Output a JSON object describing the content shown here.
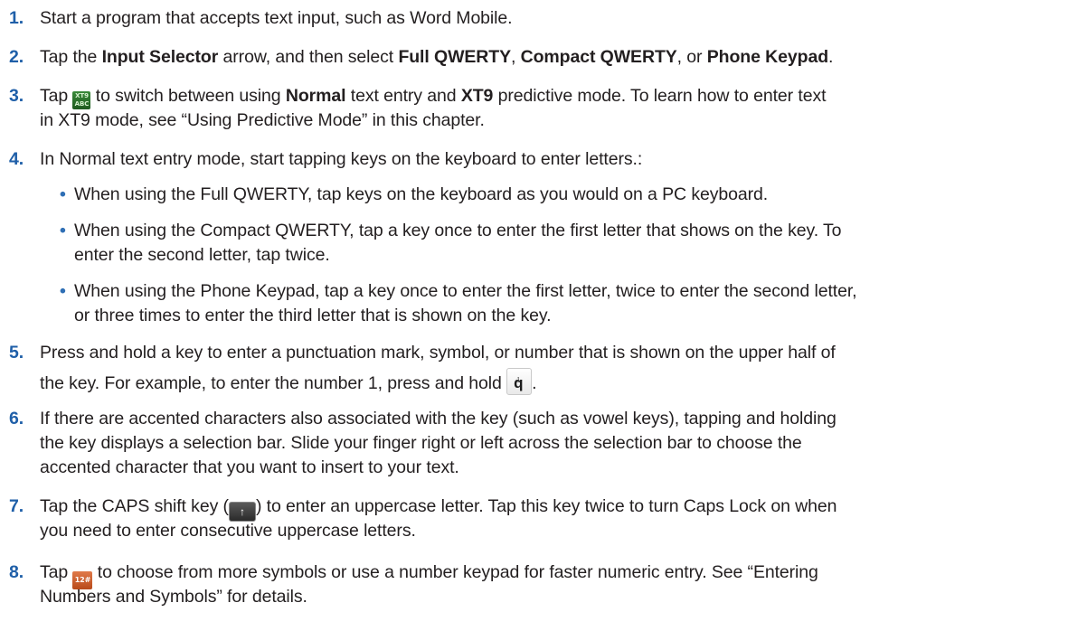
{
  "steps": {
    "s1": {
      "num": "1.",
      "text": "Start a program that accepts text input, such as Word Mobile."
    },
    "s2": {
      "num": "2.",
      "t1": "Tap the ",
      "b1": "Input Selector",
      "t2": " arrow, and then select ",
      "b2": "Full QWERTY",
      "t3": ", ",
      "b3": "Compact QWERTY",
      "t4": ", or ",
      "b4": "Phone Keypad",
      "t5": "."
    },
    "s3": {
      "num": "3.",
      "t1": "Tap ",
      "t2": " to switch between using ",
      "b1": "Normal",
      "t3": " text entry and ",
      "b2": "XT9",
      "t4": " predictive mode. To learn how to enter text",
      "line2": "in XT9 mode, see “Using Predictive Mode” in this chapter."
    },
    "s4": {
      "num": "4.",
      "text": "In Normal text entry mode, start tapping keys on the keyboard to enter letters.:",
      "bullets": [
        {
          "line1": "When using the Full QWERTY, tap keys on the keyboard as you would on a PC keyboard."
        },
        {
          "line1": "When using the Compact QWERTY, tap a key once to enter the first letter that shows on the key. To",
          "line2": "enter the second letter, tap twice."
        },
        {
          "line1": "When using the Phone Keypad, tap a key once to enter the first letter, twice to enter the second letter,",
          "line2": "or three times to enter the third letter that is shown on the key."
        }
      ]
    },
    "s5": {
      "num": "5.",
      "line1": "Press and hold a key to enter a punctuation mark, symbol, or number that is shown on the upper half of",
      "line2a": "the key. For example, to enter the number 1, press and hold ",
      "line2b": "."
    },
    "s6": {
      "num": "6.",
      "line1": "If there are accented characters also associated with the key (such as vowel keys), tapping and holding",
      "line2": "the key displays a selection bar. Slide your finger right or left across the selection bar to choose the",
      "line3": "accented character that you want to insert to your text."
    },
    "s7": {
      "num": "7.",
      "line1a": "Tap the CAPS shift key (",
      "line1b": ") to enter an uppercase letter. Tap this key twice to turn Caps Lock on when",
      "line2": "you need to enter consecutive uppercase letters."
    },
    "s8": {
      "num": "8.",
      "line1a": "Tap ",
      "line1b": " to choose from more symbols or use a number keypad for faster numeric entry. See “Entering",
      "line2": "Numbers and Symbols” for details."
    }
  },
  "icons": {
    "xt9": {
      "name": "xt9-mode-icon",
      "top": "XT9",
      "bottom": "ABC",
      "color": "#2f7a2f"
    },
    "q_key": {
      "name": "q-key-icon",
      "tiny": "1",
      "main": "q"
    },
    "shift": {
      "name": "caps-shift-icon",
      "glyph": "↑"
    },
    "sym": {
      "name": "symbols-12-icon",
      "label": "12#",
      "color": "#c85a28"
    }
  },
  "colors": {
    "number": "#1f5fa8",
    "bullet": "#2f6fb5",
    "text": "#231f20"
  }
}
